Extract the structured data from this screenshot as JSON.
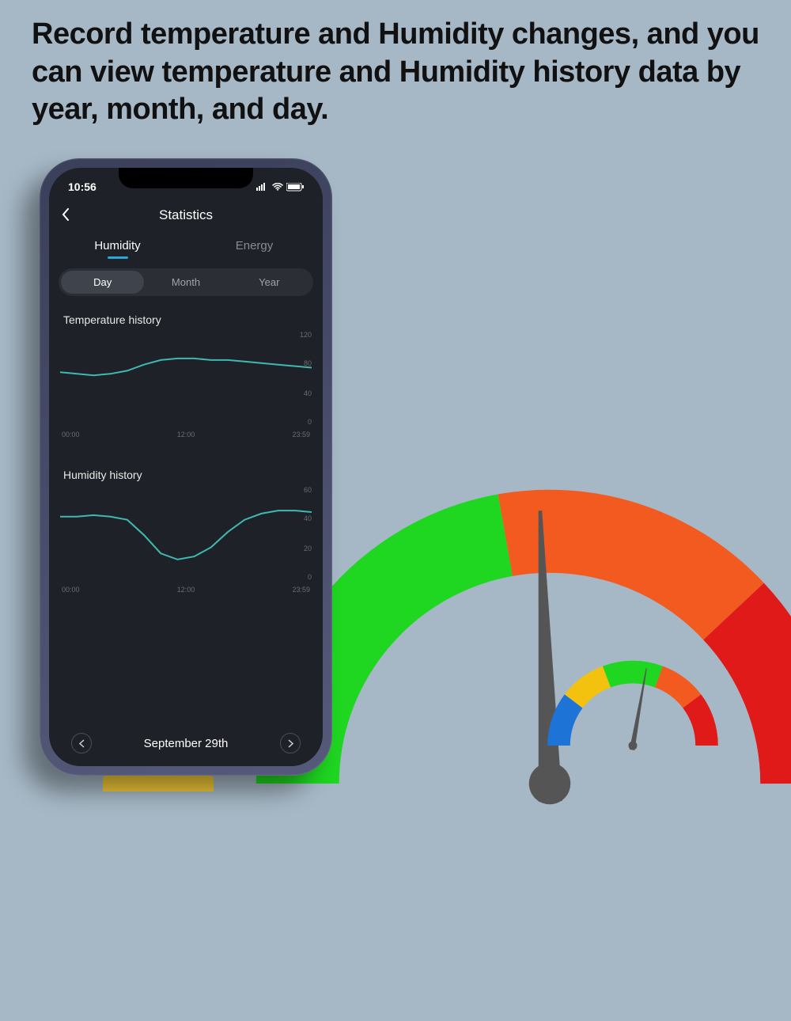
{
  "headline": "Record temperature and Humidity changes, and you can view temperature and Humidity history data by year, month, and day.",
  "status": {
    "time": "10:56"
  },
  "nav": {
    "title": "Statistics"
  },
  "tabs": {
    "humidity": "Humidity",
    "energy": "Energy"
  },
  "segment": {
    "day": "Day",
    "month": "Month",
    "year": "Year"
  },
  "sections": {
    "temp_title": "Temperature history",
    "hum_title": "Humidity history"
  },
  "date": {
    "label": "September 29th"
  },
  "chart_data": [
    {
      "type": "line",
      "title": "Temperature history",
      "xlabel": "",
      "ylabel": "",
      "ylim": [
        0,
        120
      ],
      "yticks": [
        0,
        40,
        80,
        120
      ],
      "x": [
        "00:00",
        "12:00",
        "23:59"
      ],
      "series": [
        {
          "name": "temperature",
          "values": [
            70,
            68,
            66,
            68,
            72,
            80,
            86,
            88,
            88,
            86,
            86,
            84,
            82,
            80,
            78,
            76
          ]
        }
      ]
    },
    {
      "type": "line",
      "title": "Humidity history",
      "xlabel": "",
      "ylabel": "",
      "ylim": [
        0,
        60
      ],
      "yticks": [
        0,
        20,
        40,
        60
      ],
      "x": [
        "00:00",
        "12:00",
        "23:59"
      ],
      "series": [
        {
          "name": "humidity",
          "values": [
            42,
            42,
            43,
            42,
            40,
            30,
            18,
            14,
            16,
            22,
            32,
            40,
            44,
            46,
            46,
            45
          ]
        }
      ]
    }
  ],
  "gauge": {
    "segments": [
      "green",
      "orange",
      "red"
    ],
    "needle_angle_deg": 88
  },
  "gauge_small": {
    "segments": [
      "blue",
      "yellow",
      "green",
      "orange",
      "red"
    ],
    "needle_angle_deg": 100
  }
}
